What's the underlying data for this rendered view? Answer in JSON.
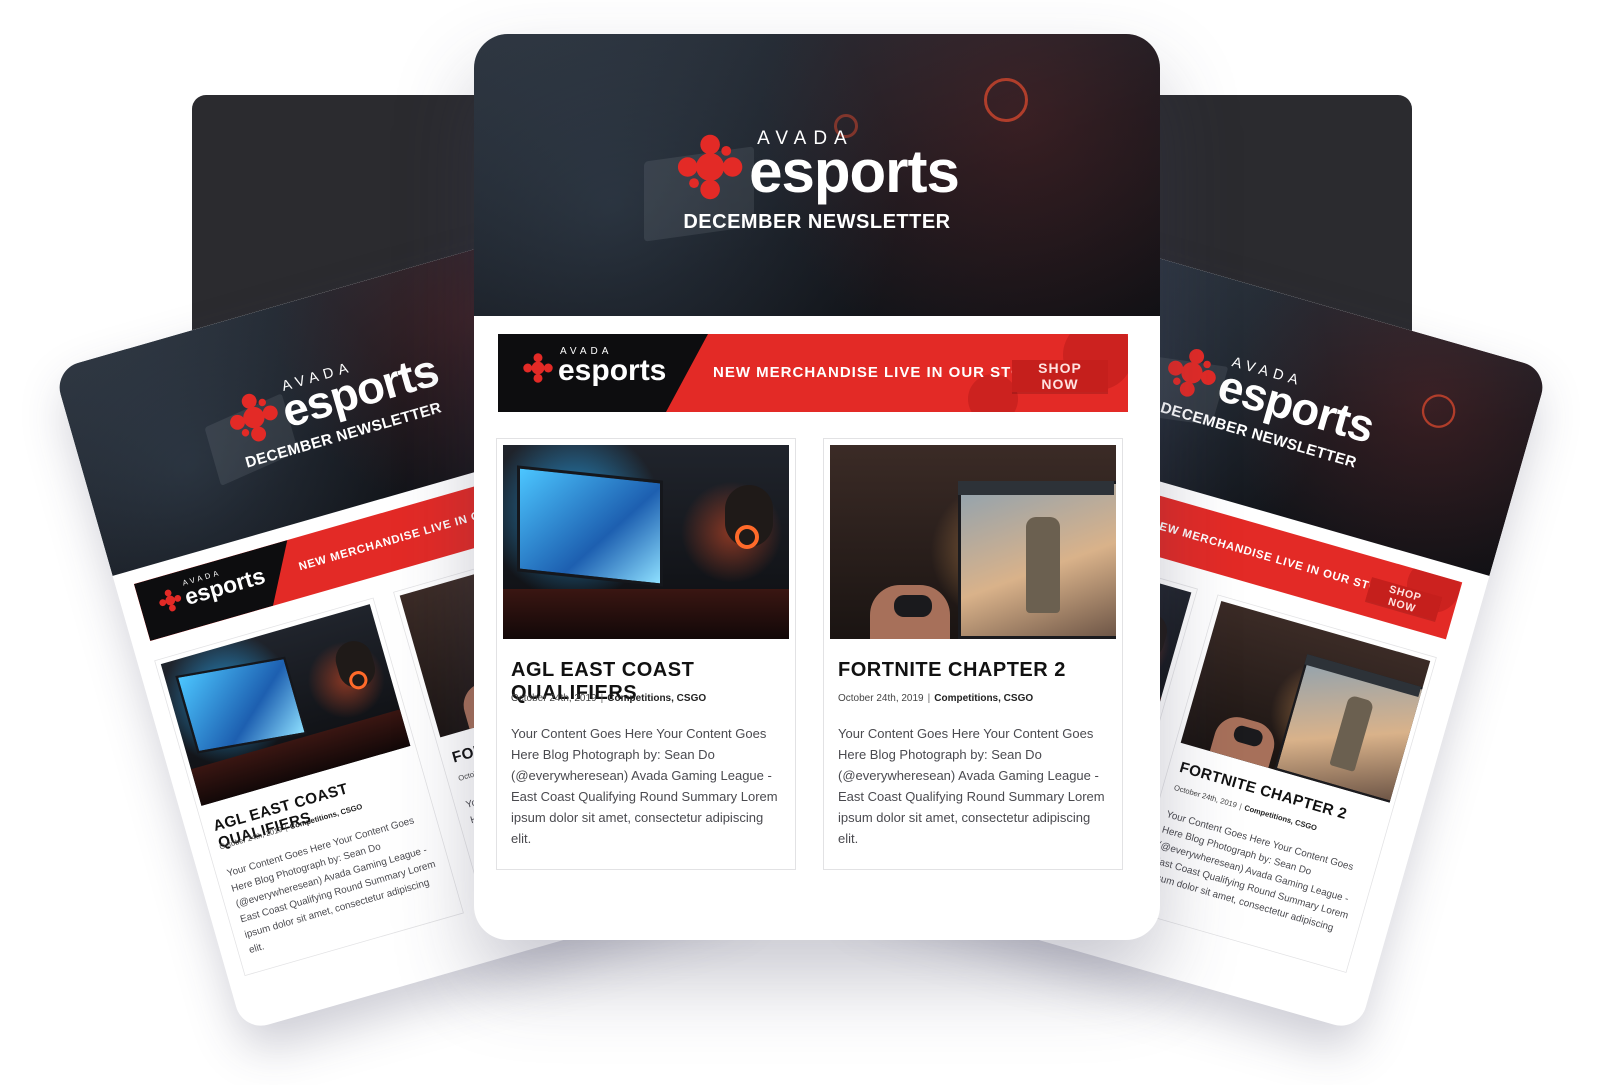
{
  "brand": {
    "logo_top": "AVADA",
    "logo_main": "esports",
    "accent_color": "#e32a26"
  },
  "newsletter": {
    "title": "DECEMBER NEWSLETTER"
  },
  "banner": {
    "text": "NEW MERCHANDISE LIVE IN OUR STORE",
    "button_label": "SHOP NOW"
  },
  "posts": [
    {
      "title": "AGL EAST COAST QUALIFIERS",
      "date": "October 24th, 2019",
      "separator": "|",
      "categories": "Competitions, CSGO",
      "excerpt": "Your Content Goes Here Your Content Goes Here Blog Photograph by: Sean Do (@everywheresean) Avada Gaming League - East Coast Qualifying Round Summary Lorem ipsum dolor sit amet, consectetur adipiscing elit."
    },
    {
      "title": "FORTNITE CHAPTER 2",
      "date": "October 24th, 2019",
      "separator": "|",
      "categories": "Competitions, CSGO",
      "excerpt": "Your Content Goes Here Your Content Goes Here Blog Photograph by: Sean Do (@everywheresean) Avada Gaming League - East Coast Qualifying Round Summary Lorem ipsum dolor sit amet, consectetur adipiscing elit."
    }
  ]
}
